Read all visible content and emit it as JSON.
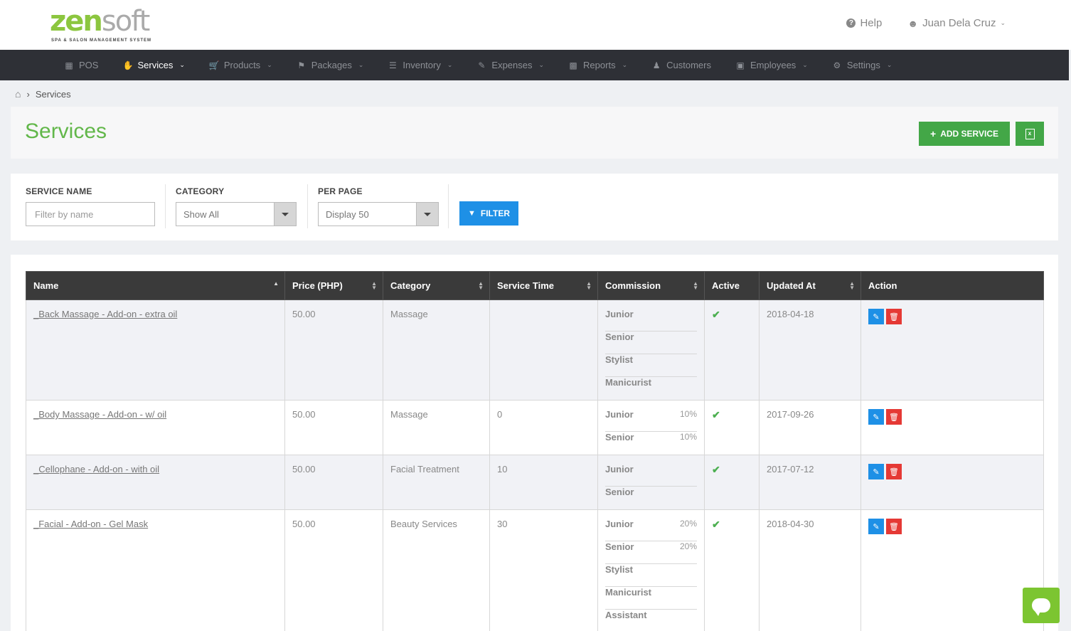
{
  "brand": {
    "name_part1": "zen",
    "name_part2": "soft",
    "tagline": "SPA & SALON MANAGEMENT SYSTEM"
  },
  "header": {
    "help_label": "Help",
    "user_name": "Juan Dela Cruz"
  },
  "nav": {
    "items": [
      {
        "label": "POS",
        "icon": "calculator-icon"
      },
      {
        "label": "Services",
        "icon": "hand-icon",
        "active": true
      },
      {
        "label": "Products",
        "icon": "cart-icon"
      },
      {
        "label": "Packages",
        "icon": "tags-icon"
      },
      {
        "label": "Inventory",
        "icon": "list-icon"
      },
      {
        "label": "Expenses",
        "icon": "edit-icon"
      },
      {
        "label": "Reports",
        "icon": "bar-chart-icon"
      },
      {
        "label": "Customers",
        "icon": "users-icon"
      },
      {
        "label": "Employees",
        "icon": "briefcase-icon"
      },
      {
        "label": "Settings",
        "icon": "gear-icon"
      }
    ]
  },
  "breadcrumb": {
    "current": "Services"
  },
  "page": {
    "title": "Services",
    "add_button": "ADD SERVICE"
  },
  "filters": {
    "service_name": {
      "label": "SERVICE NAME",
      "placeholder": "Filter by name"
    },
    "category": {
      "label": "CATEGORY",
      "value": "Show All"
    },
    "per_page": {
      "label": "PER PAGE",
      "value": "Display 50"
    },
    "filter_button": "FILTER"
  },
  "table": {
    "headers": [
      "Name",
      "Price (PHP)",
      "Category",
      "Service Time",
      "Commission",
      "Active",
      "Updated At",
      "Action"
    ],
    "rows": [
      {
        "name": "_Back Massage - Add-on - extra oil",
        "price": "50.00",
        "category": "Massage",
        "service_time": "",
        "commissions": [
          {
            "role": "Junior",
            "value": ""
          },
          {
            "role": "Senior",
            "value": ""
          },
          {
            "role": "Stylist",
            "value": ""
          },
          {
            "role": "Manicurist",
            "value": ""
          }
        ],
        "updated_at": "2018-04-18"
      },
      {
        "name": "_Body Massage - Add-on - w/ oil",
        "price": "50.00",
        "category": "Massage",
        "service_time": "0",
        "commissions": [
          {
            "role": "Junior",
            "value": "10%"
          },
          {
            "role": "Senior",
            "value": "10%"
          }
        ],
        "updated_at": "2017-09-26"
      },
      {
        "name": "_Cellophane - Add-on - with oil",
        "price": "50.00",
        "category": "Facial Treatment",
        "service_time": "10",
        "commissions": [
          {
            "role": "Junior",
            "value": ""
          },
          {
            "role": "Senior",
            "value": ""
          }
        ],
        "updated_at": "2017-07-12"
      },
      {
        "name": "_Facial - Add-on - Gel Mask",
        "price": "50.00",
        "category": "Beauty Services",
        "service_time": "30",
        "commissions": [
          {
            "role": "Junior",
            "value": "20%"
          },
          {
            "role": "Senior",
            "value": "20%"
          },
          {
            "role": "Stylist",
            "value": ""
          },
          {
            "role": "Manicurist",
            "value": ""
          },
          {
            "role": "Assistant",
            "value": ""
          }
        ],
        "updated_at": "2018-04-30"
      }
    ]
  },
  "colors": {
    "brand_green": "#8cc63f",
    "title_green": "#62b74a",
    "button_green": "#43a747",
    "filter_blue": "#1e90e6",
    "delete_red": "#e53935",
    "nav_bg": "#2e3036"
  }
}
